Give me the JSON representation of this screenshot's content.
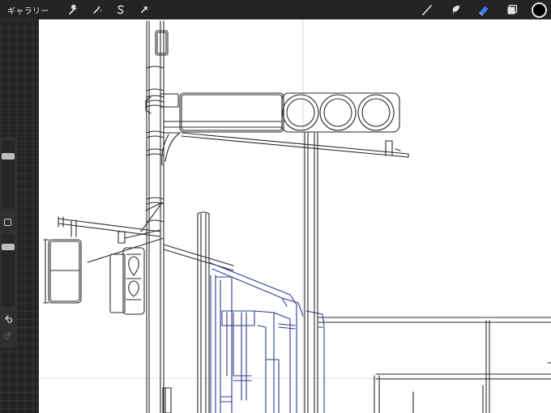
{
  "topbar": {
    "gallery_label": "ギャラリー",
    "left_tools": [
      {
        "name": "actions",
        "icon": "wrench-icon"
      },
      {
        "name": "adjustments",
        "icon": "magic-wand-icon"
      },
      {
        "name": "selection",
        "icon": "selection-s-icon"
      },
      {
        "name": "transform",
        "icon": "arrow-cursor-icon"
      }
    ],
    "right_tools": [
      {
        "name": "brush",
        "icon": "brush-icon",
        "active": false
      },
      {
        "name": "smudge",
        "icon": "smudge-icon",
        "active": false
      },
      {
        "name": "eraser",
        "icon": "eraser-icon",
        "active": true
      },
      {
        "name": "layers",
        "icon": "layers-icon",
        "active": false
      }
    ],
    "current_color": "#000000",
    "active_color": "#3d7bf5"
  },
  "sidebar": {
    "brush_size_level": 0.2,
    "opacity_level": 0.05
  },
  "canvas": {
    "background": "#ffffff",
    "line_color": "#2a2a2a",
    "blue_line_color": "#2b3b8c"
  }
}
